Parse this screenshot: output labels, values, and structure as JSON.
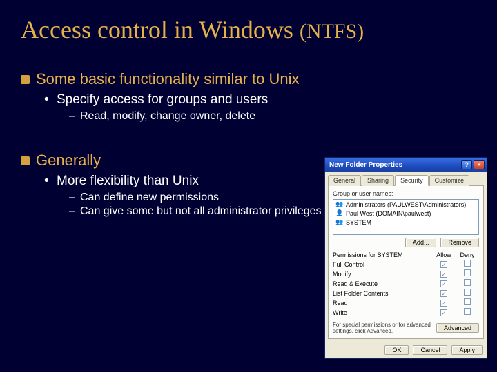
{
  "title": {
    "main": "Access control in Windows",
    "sub": "(NTFS)"
  },
  "bullets": {
    "b1": "Some basic functionality similar to Unix",
    "b1_1": "Specify access for groups and users",
    "b1_1_1": "Read, modify, change owner, delete",
    "b2": "Generally",
    "b2_1": "More flexibility than Unix",
    "b2_1_1": "Can define new permissions",
    "b2_1_2": "Can give some but not all administrator privileges"
  },
  "dialog": {
    "title": "New Folder Properties",
    "tabs": {
      "t1": "General",
      "t2": "Sharing",
      "t3": "Security",
      "t4": "Customize"
    },
    "group_label": "Group or user names:",
    "users": {
      "u1": "Administrators (PAULWEST\\Administrators)",
      "u2": "Paul West (DOMAIN\\paulwest)",
      "u3": "SYSTEM"
    },
    "add_btn": "Add...",
    "remove_btn": "Remove",
    "perm_label": "Permissions for SYSTEM",
    "allow": "Allow",
    "deny": "Deny",
    "perms": {
      "p1": "Full Control",
      "p2": "Modify",
      "p3": "Read & Execute",
      "p4": "List Folder Contents",
      "p5": "Read",
      "p6": "Write"
    },
    "adv_text": "For special permissions or for advanced settings, click Advanced.",
    "adv_btn": "Advanced",
    "ok": "OK",
    "cancel": "Cancel",
    "apply": "Apply"
  }
}
